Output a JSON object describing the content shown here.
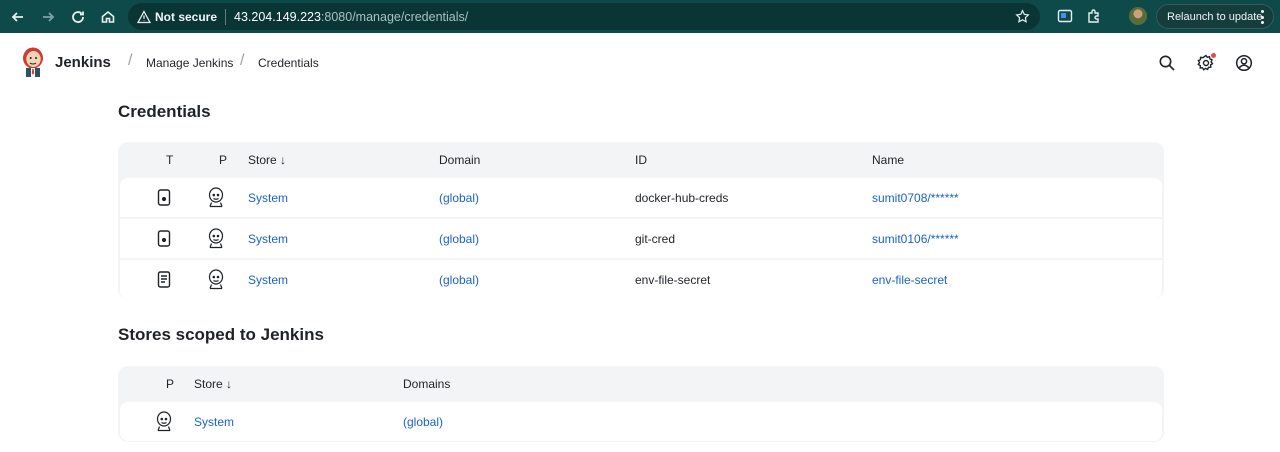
{
  "browser": {
    "security_label": "Not secure",
    "url_host": "43.204.149.223",
    "url_path": ":8080/manage/credentials/",
    "relaunch_label": "Relaunch to update"
  },
  "header": {
    "brand": "Jenkins",
    "breadcrumbs": [
      "Manage Jenkins",
      "Credentials"
    ]
  },
  "credentials": {
    "title": "Credentials",
    "columns": [
      "T",
      "P",
      "Store ↓",
      "Domain",
      "ID",
      "Name"
    ],
    "rows": [
      {
        "type_icon": "mobile-credential-icon",
        "store": "System",
        "domain": "(global)",
        "id": "docker-hub-creds",
        "name": "sumit0708/******"
      },
      {
        "type_icon": "mobile-credential-icon",
        "store": "System",
        "domain": "(global)",
        "id": "git-cred",
        "name": "sumit0106/******"
      },
      {
        "type_icon": "secret-file-icon",
        "store": "System",
        "domain": "(global)",
        "id": "env-file-secret",
        "name": "env-file-secret"
      }
    ]
  },
  "stores": {
    "title": "Stores scoped to Jenkins",
    "columns": [
      "P",
      "Store ↓",
      "Domains"
    ],
    "rows": [
      {
        "store": "System",
        "domain": "(global)"
      }
    ]
  },
  "colors": {
    "browser_bar": "#0f4a4a",
    "link": "#1a62c9",
    "table_bg": "#f2f4f6",
    "notification": "#e5484d"
  }
}
